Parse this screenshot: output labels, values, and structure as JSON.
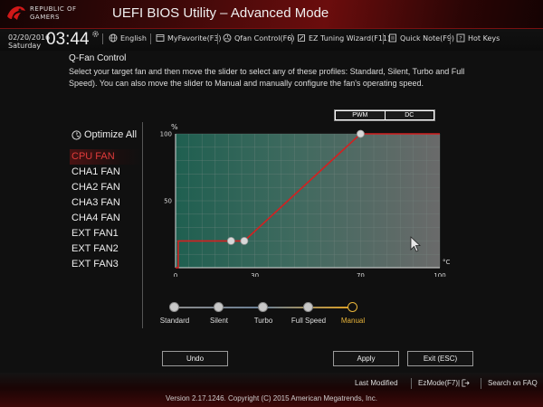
{
  "header": {
    "brand_line1": "REPUBLIC OF",
    "brand_line2": "GAMERS",
    "title": "UEFI BIOS Utility – Advanced Mode",
    "date": "02/20/2016",
    "weekday": "Saturday",
    "time": "03:44",
    "items": [
      {
        "label": "English",
        "icon": "globe-icon"
      },
      {
        "label": "MyFavorite(F3)",
        "icon": "favorite-icon"
      },
      {
        "label": "Qfan Control(F6)",
        "icon": "fan-icon"
      },
      {
        "label": "EZ Tuning Wizard(F11)",
        "icon": "wizard-icon"
      },
      {
        "label": "Quick Note(F9)",
        "icon": "note-icon"
      },
      {
        "label": "Hot Keys",
        "icon": "help-icon"
      }
    ]
  },
  "content": {
    "title": "Q-Fan Control",
    "description": "Select your target fan and then move the slider to select any of these profiles: Standard, Silent, Turbo and Full Speed). You can also move the slider to Manual and manually configure the fan's operating speed."
  },
  "fans": {
    "optimize_label": "Optimize All",
    "items": [
      "CPU FAN",
      "CHA1 FAN",
      "CHA2 FAN",
      "CHA3 FAN",
      "CHA4 FAN",
      "EXT FAN1",
      "EXT FAN2",
      "EXT FAN3"
    ],
    "selected": "CPU FAN"
  },
  "mode": {
    "pwm_label": "PWM",
    "dc_label": "DC",
    "selected": "PWM"
  },
  "chart_data": {
    "type": "line",
    "ylabel": "%",
    "xlabel": "°C",
    "x_ticks": [
      "0",
      "30",
      "70",
      "100"
    ],
    "y_ticks": [
      "50",
      "100"
    ],
    "xlim": [
      0,
      100
    ],
    "ylim": [
      0,
      100
    ],
    "series": [
      {
        "points": [
          [
            0,
            0
          ],
          [
            1,
            0
          ],
          [
            1,
            20
          ],
          [
            21,
            20
          ],
          [
            26,
            20
          ],
          [
            70,
            100
          ],
          [
            100,
            100
          ]
        ],
        "control_points": [
          [
            21,
            20
          ],
          [
            26,
            20
          ],
          [
            70,
            100
          ]
        ]
      }
    ],
    "grid": true,
    "colors": {
      "line": "#d42020",
      "fill_dark": "#1f5f50",
      "grid": "#7a8a85",
      "point": "#d8d8d8"
    }
  },
  "profiles": {
    "items": [
      "Standard",
      "Silent",
      "Turbo",
      "Full Speed",
      "Manual"
    ],
    "selected": "Manual"
  },
  "buttons": {
    "undo": "Undo",
    "apply": "Apply",
    "exit": "Exit (ESC)"
  },
  "footer": {
    "last_modified": "Last Modified",
    "ezmode": "EzMode(F7)|",
    "search": "Search on FAQ",
    "version": "Version 2.17.1246. Copyright (C) 2015 American Megatrends, Inc."
  }
}
